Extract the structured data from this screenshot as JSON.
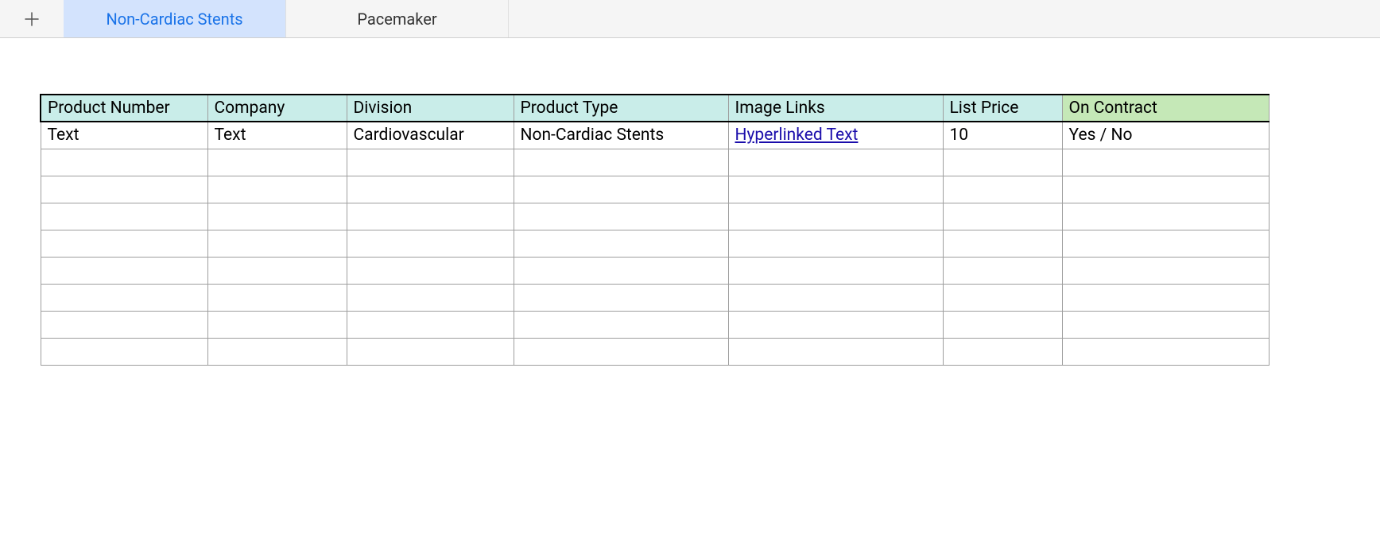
{
  "tabs": {
    "items": [
      {
        "label": "Non-Cardiac Stents",
        "active": true
      },
      {
        "label": "Pacemaker",
        "active": false
      }
    ]
  },
  "table": {
    "headers": [
      "Product Number",
      "Company",
      "Division",
      "Product Type",
      "Image Links",
      "List Price",
      "On Contract"
    ],
    "row": {
      "product_number": "Text",
      "company": "Text",
      "division": "Cardiovascular",
      "product_type": "Non-Cardiac Stents",
      "image_links": "Hyperlinked Text",
      "list_price": "10",
      "on_contract": "Yes / No"
    }
  }
}
